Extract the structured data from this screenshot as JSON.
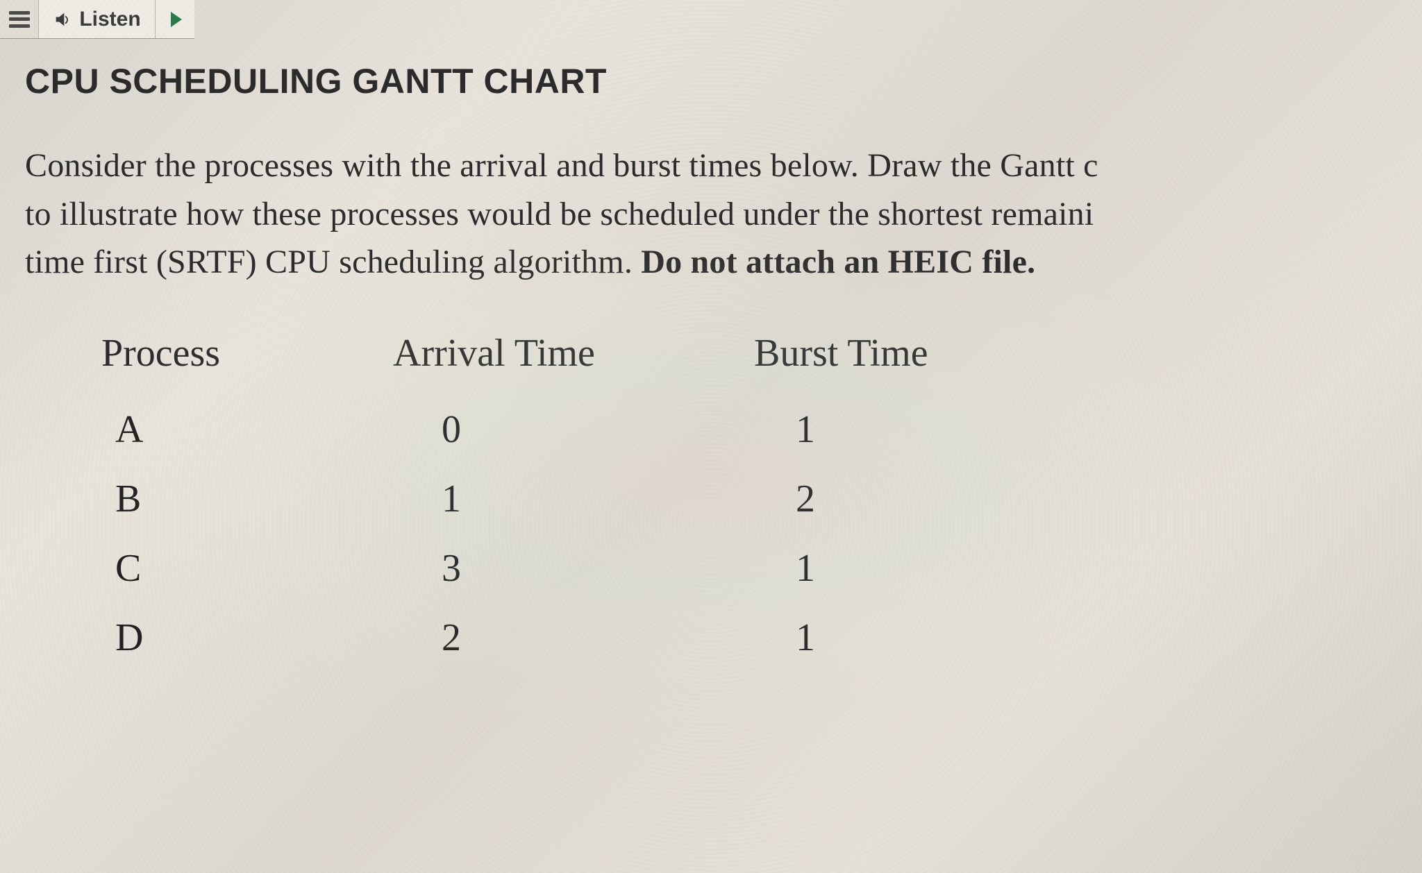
{
  "toolbar": {
    "listen_label": "Listen"
  },
  "heading": "CPU SCHEDULING GANTT CHART",
  "prompt": {
    "line1": "Consider the processes with the arrival and burst times below. Draw the Gantt c",
    "line2": "to illustrate how these processes would be scheduled under the shortest remaini",
    "line3_prefix": "time first (SRTF) CPU scheduling algorithm. ",
    "line3_bold": "Do not attach an HEIC file."
  },
  "table": {
    "headers": {
      "process": "Process",
      "arrival": "Arrival Time",
      "burst": "Burst Time"
    },
    "rows": [
      {
        "process": "A",
        "arrival": "0",
        "burst": "1"
      },
      {
        "process": "B",
        "arrival": "1",
        "burst": "2"
      },
      {
        "process": "C",
        "arrival": "3",
        "burst": "1"
      },
      {
        "process": "D",
        "arrival": "2",
        "burst": "1"
      }
    ]
  },
  "chart_data": {
    "type": "table",
    "title": "CPU SCHEDULING GANTT CHART",
    "columns": [
      "Process",
      "Arrival Time",
      "Burst Time"
    ],
    "rows": [
      [
        "A",
        0,
        1
      ],
      [
        "B",
        1,
        2
      ],
      [
        "C",
        3,
        1
      ],
      [
        "D",
        2,
        1
      ]
    ]
  }
}
